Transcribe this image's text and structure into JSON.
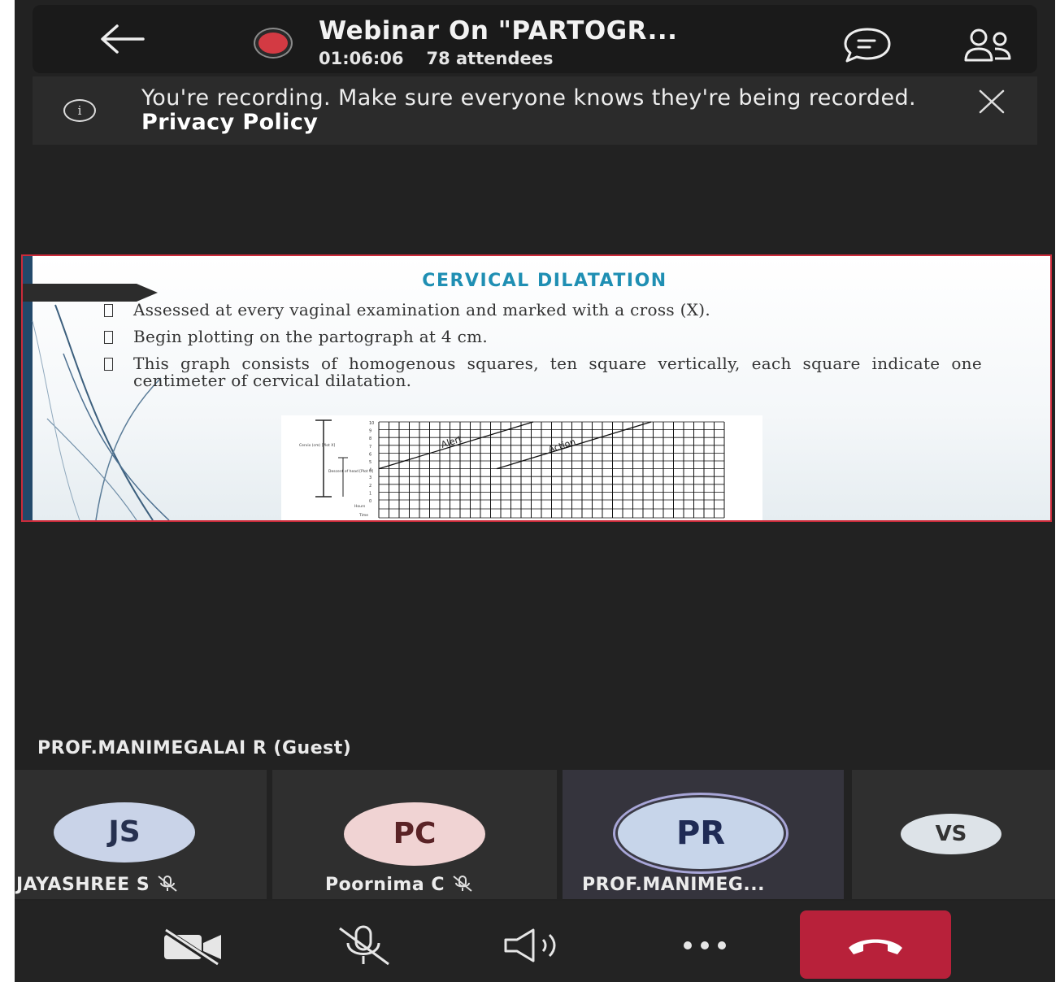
{
  "header": {
    "title": "Webinar On \"PARTOGR...",
    "duration": "01:06:06",
    "attendees": "78 attendees"
  },
  "banner": {
    "message": "You're recording. Make sure everyone knows they're being recorded.",
    "link": "Privacy Policy"
  },
  "slide": {
    "title": "CERVICAL DILATATION",
    "bullets": [
      "Assessed at every vaginal examination and marked  with a cross (X).",
      "Begin plotting on the partograph at 4 cm.",
      "This graph consists of homogenous squares, ten  square vertically, each square indicate one centimeter  of cervical dilatation."
    ],
    "graph": {
      "line_labels": [
        "Alert",
        "Action"
      ],
      "y_ticks": [
        "10",
        "9",
        "8",
        "7",
        "6",
        "5",
        "4",
        "3",
        "2",
        "1",
        "0"
      ],
      "side_label_1": "Cervix (cm) [Plot X]",
      "side_label_2": "Descent of head [Plot O]",
      "bottom_labels": [
        "Hours",
        "Time"
      ]
    }
  },
  "speaker_label": "PROF.MANIMEGALAI R (Guest)",
  "participants": [
    {
      "initials": "JS",
      "name": "JAYASHREE S",
      "muted": true,
      "avatar_bg": "#c9d3e8",
      "avatar_fg": "#26304f"
    },
    {
      "initials": "PC",
      "name": "Poornima C",
      "muted": true,
      "avatar_bg": "#f0d3d3",
      "avatar_fg": "#5a2326"
    },
    {
      "initials": "PR",
      "name": "PROF.MANIMEG...",
      "muted": false,
      "avatar_bg": "#c7d5ea",
      "avatar_fg": "#1f2b55"
    },
    {
      "initials": "VS",
      "name": "",
      "muted": false,
      "avatar_bg": "#dde3e8",
      "avatar_fg": "#333"
    }
  ],
  "controls": {
    "icons": [
      "camera-off-icon",
      "mic-off-icon",
      "speaker-icon",
      "more-icon",
      "hang-up-icon"
    ],
    "hangup_color": "#b8213a"
  },
  "colors": {
    "record": "#d33a43",
    "slide_title": "#1f8fb3",
    "slide_border": "#cc2b3a"
  }
}
